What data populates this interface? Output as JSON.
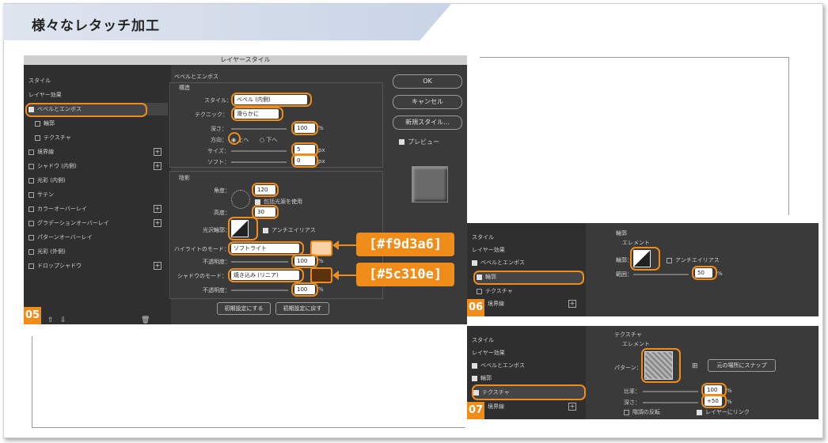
{
  "page": {
    "heading": "様々なレタッチ加工"
  },
  "dialog5": {
    "title": "レイヤースタイル",
    "left_panel": {
      "header": "スタイル",
      "items": [
        {
          "label": "レイヤー効果"
        },
        {
          "label": "ベベルとエンボス"
        },
        {
          "label": "輪郭"
        },
        {
          "label": "テクスチャ"
        },
        {
          "label": "境界線"
        },
        {
          "label": "シャドウ (内側)"
        },
        {
          "label": "光彩 (内側)"
        },
        {
          "label": "サテン"
        },
        {
          "label": "カラーオーバーレイ"
        },
        {
          "label": "グラデーションオーバーレイ"
        },
        {
          "label": "パターンオーバーレイ"
        },
        {
          "label": "光彩 (外側)"
        },
        {
          "label": "ドロップシャドウ"
        }
      ]
    },
    "bevel": {
      "section_title": "ベベルとエンボス",
      "structure_title": "構造",
      "style_label": "スタイル：",
      "style_value": "ベベル (内側)",
      "technique_label": "テクニック：",
      "technique_value": "滑らかに",
      "depth_label": "深さ：",
      "depth_value": "100",
      "percent": "%",
      "direction_label": "方向：",
      "dir_up": "上へ",
      "dir_down": "下へ",
      "size_label": "サイズ：",
      "size_value": "5",
      "px": "px",
      "soften_label": "ソフト：",
      "soften_value": "0"
    },
    "shading": {
      "title": "陰影",
      "angle_label": "角度：",
      "angle_value": "120",
      "global_light": "包括光源を使用",
      "altitude_label": "高度：",
      "altitude_value": "30",
      "gloss_label": "光沢輪郭：",
      "antialias": "アンチエイリアス",
      "highlight_mode_label": "ハイライトのモード：",
      "highlight_mode": "ソフトライト",
      "highlight_opacity_label": "不透明度：",
      "highlight_opacity": "100",
      "shadow_mode_label": "シャドウのモード：",
      "shadow_mode": "焼き込み (リニア)",
      "shadow_opacity_label": "不透明度：",
      "shadow_opacity": "100",
      "highlight_color": "#f9d3a6",
      "shadow_color": "#5c310e"
    },
    "bottom": {
      "make_default": "初期設定にする",
      "reset_default": "初期設定に戻す"
    },
    "buttons": {
      "ok": "OK",
      "cancel": "キャンセル",
      "new_style": "新規スタイル...",
      "preview": "プレビュー"
    },
    "step": "05"
  },
  "tags": {
    "highlight": "[#f9d3a6]",
    "shadow": "[#5c310e]"
  },
  "dialog6": {
    "left": {
      "header": "スタイル",
      "effects": "レイヤー効果",
      "bevel": "ベベルとエンボス",
      "contour": "輪郭",
      "texture": "テクスチャ",
      "stroke": "境界線"
    },
    "section_title": "輪郭",
    "element_title": "エレメント",
    "contour_label": "輪郭：",
    "antialias": "アンチエイリアス",
    "range_label": "範囲：",
    "range_value": "50",
    "percent": "%",
    "step": "06"
  },
  "dialog7": {
    "left": {
      "header": "スタイル",
      "effects": "レイヤー効果",
      "bevel": "ベベルとエンボス",
      "contour": "輪郭",
      "texture": "テクスチャ",
      "stroke": "境界線"
    },
    "section_title": "テクスチャ",
    "element_title": "エレメント",
    "pattern_label": "パターン：",
    "snap_button": "元の場所にスナップ",
    "scale_label": "比率：",
    "scale_value": "100",
    "depth_label": "深さ：",
    "depth_value": "+50",
    "percent": "%",
    "invert": "階調の反転",
    "link": "レイヤーにリンク",
    "step": "07"
  }
}
